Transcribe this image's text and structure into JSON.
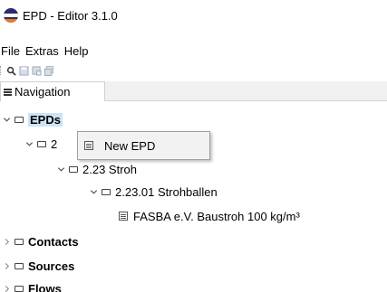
{
  "window": {
    "title": "EPD - Editor 3.1.0"
  },
  "menubar": {
    "items": [
      "File",
      "Extras",
      "Help"
    ]
  },
  "toolbar": {
    "buttons": [
      "search-icon",
      "save-icon",
      "save-as-icon",
      "save-all-icon"
    ]
  },
  "navigation": {
    "tab_label": "Navigation"
  },
  "tree": {
    "epds_label": "EPDs",
    "cat2_label_visible": "2",
    "cat223_label": "2.23 Stroh",
    "cat22301_label": "2.23.01 Strohballen",
    "epd_item_label": "FASBA e.V. Baustroh 100 kg/m³",
    "contacts_label": "Contacts",
    "sources_label": "Sources",
    "flows_label": "Flows"
  },
  "context_menu": {
    "new_epd_label": "New EPD"
  }
}
